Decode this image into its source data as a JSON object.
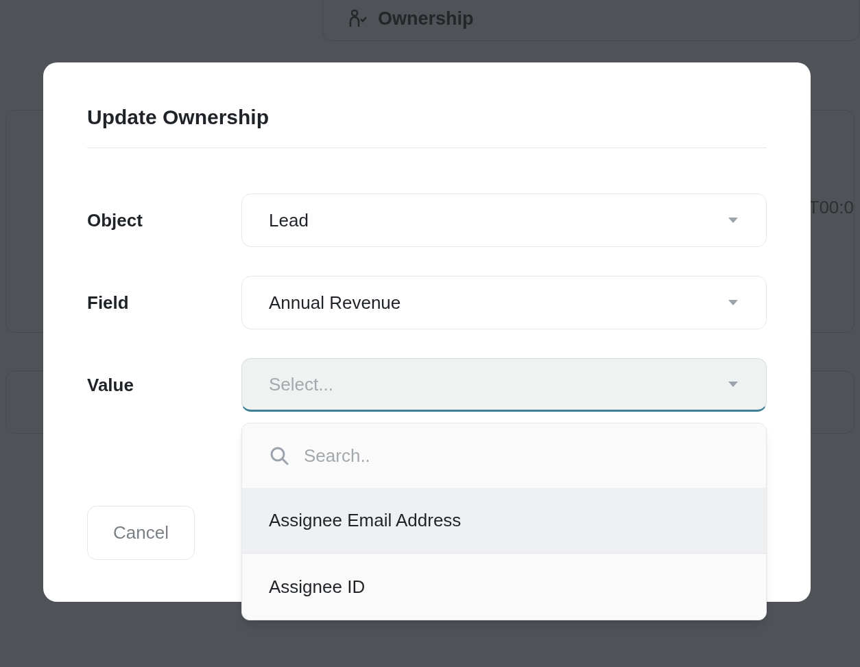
{
  "background": {
    "tab": {
      "label": "Ownership"
    },
    "cell_right": "T00:0"
  },
  "dialog": {
    "title": "Update Ownership",
    "fields": [
      {
        "label": "Object",
        "value": "Lead",
        "focused": false
      },
      {
        "label": "Field",
        "value": "Annual Revenue",
        "focused": false
      },
      {
        "label": "Value",
        "placeholder": "Select...",
        "focused": true
      }
    ],
    "dropdown": {
      "search_placeholder": "Search..",
      "options": [
        {
          "label": "Assignee Email Address",
          "highlighted": true
        },
        {
          "label": "Assignee ID",
          "highlighted": false
        }
      ]
    },
    "buttons": [
      {
        "label": "Cancel"
      }
    ]
  }
}
